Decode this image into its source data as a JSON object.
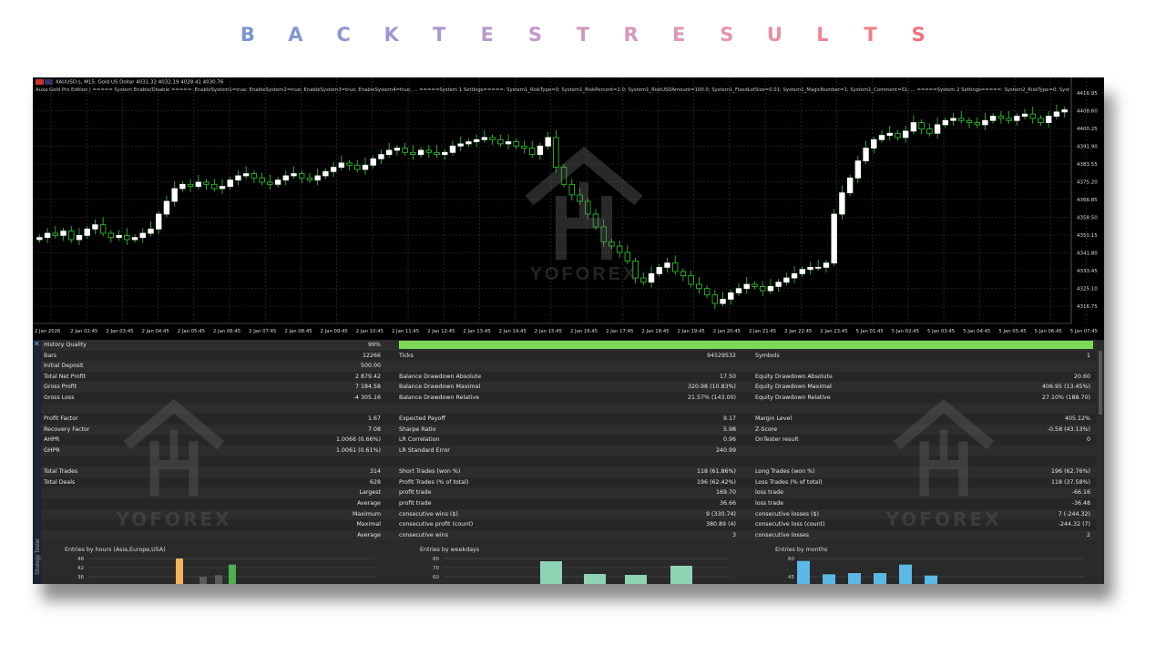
{
  "page_title_letters": [
    {
      "ch": "B",
      "color": "#7a95cf"
    },
    {
      "ch": "A",
      "color": "#8596d0"
    },
    {
      "ch": "C",
      "color": "#9197d0"
    },
    {
      "ch": "K",
      "color": "#9d98cf"
    },
    {
      "ch": "T",
      "color": "#aa99cd"
    },
    {
      "ch": "E",
      "color": "#b79acb"
    },
    {
      "ch": "S",
      "color": "#c49ac8"
    },
    {
      "ch": "T",
      "color": "#cf98c2"
    },
    {
      "ch": "R",
      "color": "#d898bc"
    },
    {
      "ch": "E",
      "color": "#df97b5"
    },
    {
      "ch": "S",
      "color": "#e595ac"
    },
    {
      "ch": "U",
      "color": "#ea8ea3"
    },
    {
      "ch": "L",
      "color": "#ef8698"
    },
    {
      "ch": "T",
      "color": "#f27b8a"
    },
    {
      "ch": "S",
      "color": "#f56e7c"
    }
  ],
  "chart": {
    "header": "XAUUSD.s, M15:  Gold US Dollar  4031.32 4032.19 4028.41 4030.76",
    "params": "Auxa Gold Pro Edition | ===== System Enable/Disable =====: EnableSystem1=true; EnableSystem2=true; EnableSystem3=true; EnableSystem4=true; ... =====System 1 Settings=====: System1_RiskType=0; System1_RiskPercent=2.0; System1_RiskUSDAmount=100.0; System1_FixedLotSize=0.01; System1_MagicNumber=1; System1_Comment=S1; ... =====System 2 Settings=====: System2_RiskType=0; System2_RiskPercent=...",
    "price_labels": [
      "4416.95",
      "4408.60",
      "4400.25",
      "4391.90",
      "4383.55",
      "4375.20",
      "4366.85",
      "4358.50",
      "4350.15",
      "4341.80",
      "4333.45",
      "4325.10",
      "4316.75"
    ],
    "time_labels": [
      "2 Jan 2026",
      "2 Jan 02:45",
      "2 Jan 03:45",
      "2 Jan 04:45",
      "2 Jan 05:45",
      "2 Jan 06:45",
      "2 Jan 07:45",
      "2 Jan 08:45",
      "2 Jan 09:45",
      "2 Jan 10:45",
      "2 Jan 11:45",
      "2 Jan 12:45",
      "2 Jan 13:45",
      "2 Jan 14:45",
      "2 Jan 15:45",
      "2 Jan 16:45",
      "2 Jan 17:45",
      "2 Jan 18:45",
      "2 Jan 19:45",
      "2 Jan 20:45",
      "2 Jan 21:45",
      "2 Jan 22:45",
      "2 Jan 23:45",
      "5 Jan 01:45",
      "5 Jan 02:45",
      "5 Jan 03:45",
      "5 Jan 04:45",
      "5 Jan 05:45",
      "5 Jan 06:45",
      "5 Jan 07:45"
    ],
    "watermark": "YOFOREX",
    "closes": [
      4349,
      4351,
      4350,
      4352,
      4348,
      4350,
      4353,
      4355,
      4351,
      4349,
      4350,
      4348,
      4349,
      4351,
      4353,
      4360,
      4366,
      4372,
      4374,
      4373,
      4375,
      4374,
      4372,
      4373,
      4376,
      4378,
      4379,
      4377,
      4375,
      4374,
      4376,
      4378,
      4379,
      4377,
      4376,
      4378,
      4380,
      4382,
      4384,
      4383,
      4381,
      4383,
      4386,
      4388,
      4390,
      4391,
      4389,
      4388,
      4390,
      4389,
      4388,
      4389,
      4392,
      4393,
      4394,
      4395,
      4396,
      4395,
      4393,
      4394,
      4392,
      4391,
      4388,
      4392,
      4396,
      4382,
      4374,
      4369,
      4366,
      4360,
      4354,
      4347,
      4345,
      4342,
      4338,
      4330,
      4328,
      4332,
      4335,
      4337,
      4333,
      4331,
      4327,
      4325,
      4322,
      4318,
      4320,
      4323,
      4325,
      4327,
      4326,
      4324,
      4326,
      4328,
      4330,
      4332,
      4334,
      4335,
      4335,
      4337,
      4360,
      4370,
      4377,
      4385,
      4391,
      4395,
      4397,
      4398,
      4396,
      4399,
      4403,
      4400,
      4398,
      4402,
      4404,
      4405,
      4404,
      4403,
      4402,
      4404,
      4406,
      4405,
      4404,
      4406,
      4407,
      4405,
      4403,
      4406,
      4408,
      4409
    ],
    "bull_color": "#ffffff",
    "bear_color": "#2fd12f"
  },
  "stats": {
    "rows": [
      {
        "l1": "History Quality",
        "v1": "99%",
        "l2": "",
        "v2": "",
        "l3": "",
        "v3": "",
        "bar": true
      },
      {
        "l1": "Bars",
        "v1": "12266",
        "l2": "Ticks",
        "v2": "94529532",
        "l3": "Symbols",
        "v3": "1"
      },
      {
        "l1": "Initial Deposit",
        "v1": "500.00",
        "l2": "",
        "v2": "",
        "l3": "",
        "v3": ""
      },
      {
        "l1": "Total Net Profit",
        "v1": "2 879.42",
        "l2": "Balance Drawdown Absolute",
        "v2": "17.50",
        "l3": "Equity Drawdown Absolute",
        "v3": "20.60"
      },
      {
        "l1": "Gross Profit",
        "v1": "7 184.58",
        "l2": "Balance Drawdown Maximal",
        "v2": "320.98 (10.83%)",
        "l3": "Equity Drawdown Maximal",
        "v3": "406.95 (13.45%)"
      },
      {
        "l1": "Gross Loss",
        "v1": "-4 305.16",
        "l2": "Balance Drawdown Relative",
        "v2": "21.57% (143.00)",
        "l3": "Equity Drawdown Relative",
        "v3": "27.10% (188.70)"
      },
      {
        "l1": "",
        "v1": "",
        "l2": "",
        "v2": "",
        "l3": "",
        "v3": ""
      },
      {
        "l1": "Profit Factor",
        "v1": "1.67",
        "l2": "Expected Payoff",
        "v2": "9.17",
        "l3": "Margin Level",
        "v3": "405.12%"
      },
      {
        "l1": "Recovery Factor",
        "v1": "7.08",
        "l2": "Sharpe Ratio",
        "v2": "5.98",
        "l3": "Z-Score",
        "v3": "-0.58 (43.13%)"
      },
      {
        "l1": "AHPR",
        "v1": "1.0066 (0.66%)",
        "l2": "LR Correlation",
        "v2": "0.96",
        "l3": "OnTester result",
        "v3": "0"
      },
      {
        "l1": "GHPR",
        "v1": "1.0061 (0.61%)",
        "l2": "LR Standard Error",
        "v2": "240.99",
        "l3": "",
        "v3": ""
      },
      {
        "l1": "",
        "v1": "",
        "l2": "",
        "v2": "",
        "l3": "",
        "v3": ""
      },
      {
        "l1": "Total Trades",
        "v1": "314",
        "l2": "Short Trades (won %)",
        "v2": "118 (61.86%)",
        "l3": "Long Trades (won %)",
        "v3": "196 (62.76%)"
      },
      {
        "l1": "Total Deals",
        "v1": "628",
        "l2": "Profit Trades (% of total)",
        "v2": "196 (62.42%)",
        "l3": "Loss Trades (% of total)",
        "v3": "118 (37.58%)"
      },
      {
        "l1": "",
        "v1": "Largest",
        "l2": "profit trade",
        "v2": "169.70",
        "l3": "loss trade",
        "v3": "-66.16"
      },
      {
        "l1": "",
        "v1": "Average",
        "l2": "profit trade",
        "v2": "36.66",
        "l3": "loss trade",
        "v3": "-36.48"
      },
      {
        "l1": "",
        "v1": "Maximum",
        "l2": "consecutive wins ($)",
        "v2": "9 (330.74)",
        "l3": "consecutive losses ($)",
        "v3": "7 (-244.32)"
      },
      {
        "l1": "",
        "v1": "Maximal",
        "l2": "consecutive profit (count)",
        "v2": "380.89 (4)",
        "l3": "consecutive loss (count)",
        "v3": "-244.32 (7)"
      },
      {
        "l1": "",
        "v1": "Average",
        "l2": "consecutive wins",
        "v2": "3",
        "l3": "consecutive losses",
        "v3": "2"
      }
    ],
    "side_label": "Strategy Tester",
    "watermark": "YOFOREX"
  },
  "histograms": [
    {
      "title": "Entries by hours (Asia,Europe,USA)",
      "ticks": [
        "48",
        "42",
        "36"
      ],
      "bars": [
        {
          "v": 48,
          "c": "#f2b25a"
        },
        {
          "v": 36,
          "c": "#5a5a5a"
        },
        {
          "v": 37,
          "c": "#5a5a5a"
        },
        {
          "v": 44,
          "c": "#4caf50"
        }
      ]
    },
    {
      "title": "Entries by weekdays",
      "ticks": [
        "80",
        "70",
        "60"
      ],
      "bars": [
        {
          "v": 77,
          "c": "#8fd3b5"
        },
        {
          "v": 63,
          "c": "#8fd3b5"
        },
        {
          "v": 62,
          "c": "#8fd3b5"
        },
        {
          "v": 72,
          "c": "#8fd3b5"
        }
      ]
    },
    {
      "title": "Entries by months",
      "ticks": [
        "60",
        "45"
      ],
      "bars": [
        {
          "v": 58,
          "c": "#5cb8e6"
        },
        {
          "v": 47,
          "c": "#5cb8e6"
        },
        {
          "v": 48,
          "c": "#5cb8e6"
        },
        {
          "v": 48,
          "c": "#5cb8e6"
        },
        {
          "v": 55,
          "c": "#5cb8e6"
        },
        {
          "v": 46,
          "c": "#5cb8e6"
        }
      ]
    }
  ]
}
